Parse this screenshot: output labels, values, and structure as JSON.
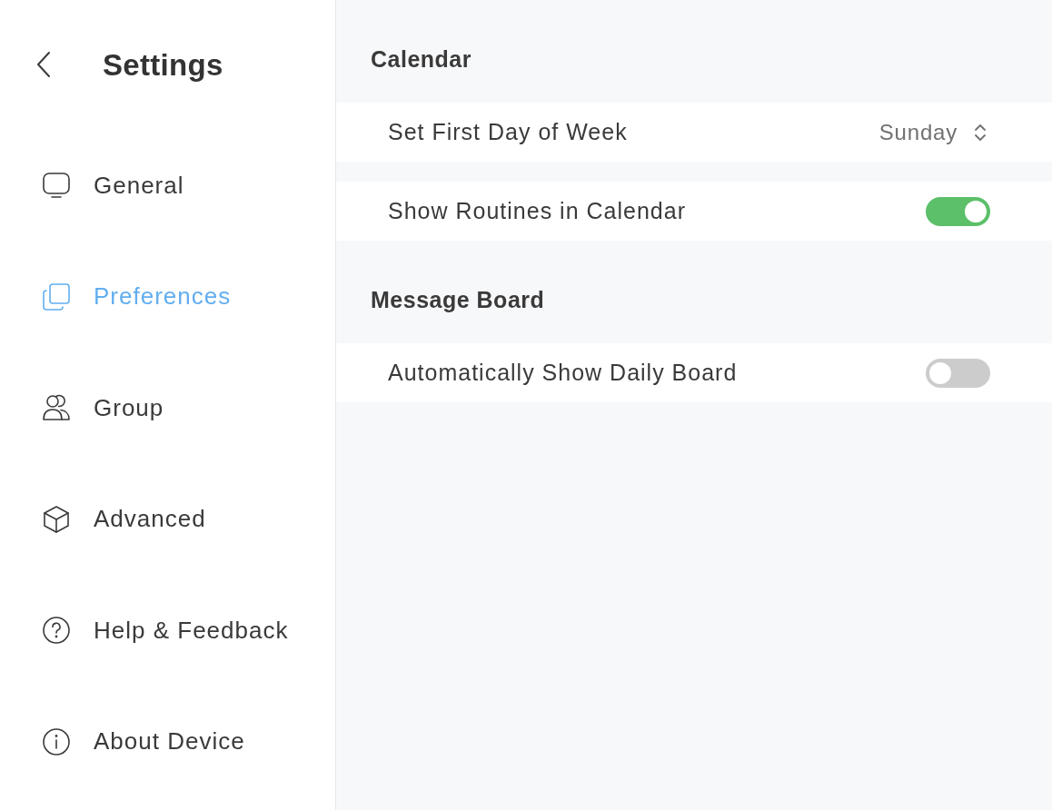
{
  "header": {
    "title": "Settings"
  },
  "sidebar": {
    "items": [
      {
        "label": "General",
        "selected": false
      },
      {
        "label": "Preferences",
        "selected": true
      },
      {
        "label": "Group",
        "selected": false
      },
      {
        "label": "Advanced",
        "selected": false
      },
      {
        "label": "Help & Feedback",
        "selected": false
      },
      {
        "label": "About Device",
        "selected": false
      }
    ]
  },
  "sections": [
    {
      "title": "Calendar",
      "rows": [
        {
          "kind": "select",
          "label": "Set First Day of Week",
          "value": "Sunday"
        },
        {
          "kind": "toggle",
          "label": "Show Routines in Calendar",
          "on": true
        }
      ]
    },
    {
      "title": "Message Board",
      "rows": [
        {
          "kind": "toggle",
          "label": "Automatically Show Daily Board",
          "on": false
        }
      ]
    }
  ]
}
